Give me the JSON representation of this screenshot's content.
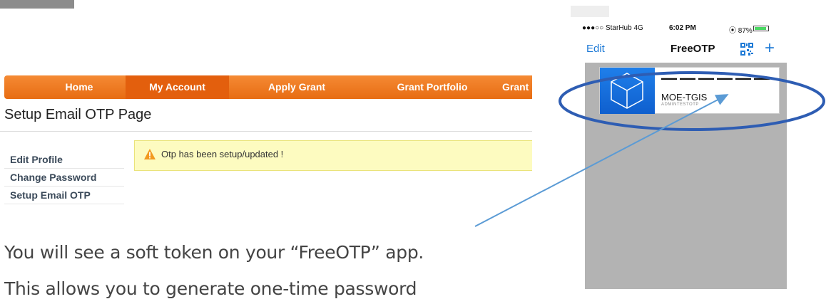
{
  "web": {
    "nav": [
      "Home",
      "My Account",
      "Apply Grant",
      "Grant Portfolio",
      "Grant"
    ],
    "active_nav": "My Account",
    "page_title": "Setup Email OTP Page",
    "side_menu": [
      "Edit Profile",
      "Change Password",
      "Setup Email OTP"
    ],
    "alert": "Otp has been setup/updated !"
  },
  "caption": {
    "line1": "You will see a soft token on your “FreeOTP” app.",
    "line2": "This allows you to generate one-time password"
  },
  "phone": {
    "carrier": "●●●○○ StarHub  4G",
    "time": "6:02 PM",
    "battery_text": "⦿ 87%",
    "battery_level": 0.87,
    "edit": "Edit",
    "app_title": "FreeOTP",
    "token": {
      "code": "——————",
      "issuer": "MOE-TGIS",
      "label": "ADMINTESTOTP"
    }
  },
  "colors": {
    "nav_orange": "#f07b22",
    "alert_bg": "#fdfbc0",
    "ios_blue": "#1e7ad6",
    "annotation_blue": "#2e5db3"
  }
}
